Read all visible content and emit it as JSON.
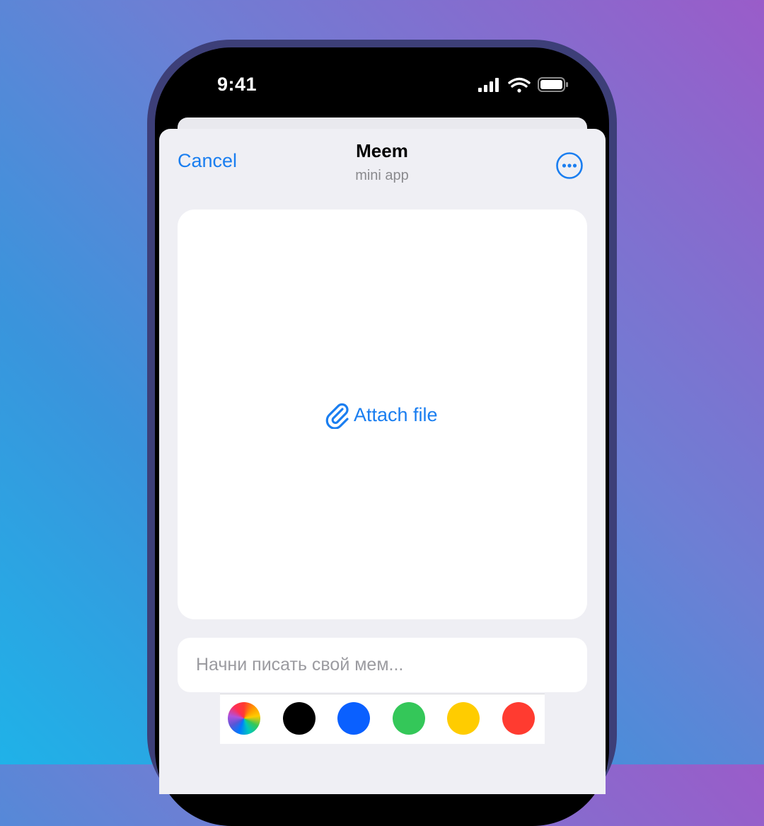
{
  "status_bar": {
    "time": "9:41",
    "icons": [
      "signal-icon",
      "wifi-icon",
      "battery-icon"
    ]
  },
  "header": {
    "cancel_label": "Cancel",
    "title": "Meem",
    "subtitle": "mini app",
    "more_icon": "more-icon"
  },
  "canvas": {
    "attach_label": "Attach file",
    "attach_icon": "paperclip-icon"
  },
  "input": {
    "placeholder": "Начни писать свой мем..."
  },
  "palette": {
    "colors": [
      {
        "name": "color-wheel",
        "value": "conic-gradient(#ff3b30, #ff9500, #ffcc00, #34c759, #00c7be, #007aff, #5856d6, #af52de, #ff2d55, #ff3b30)"
      },
      {
        "name": "black",
        "value": "#000000"
      },
      {
        "name": "blue",
        "value": "#0a60ff"
      },
      {
        "name": "green",
        "value": "#34c759"
      },
      {
        "name": "yellow",
        "value": "#ffcc00"
      },
      {
        "name": "red",
        "value": "#ff3b30"
      }
    ]
  },
  "accent_color": "#1a7ef0"
}
